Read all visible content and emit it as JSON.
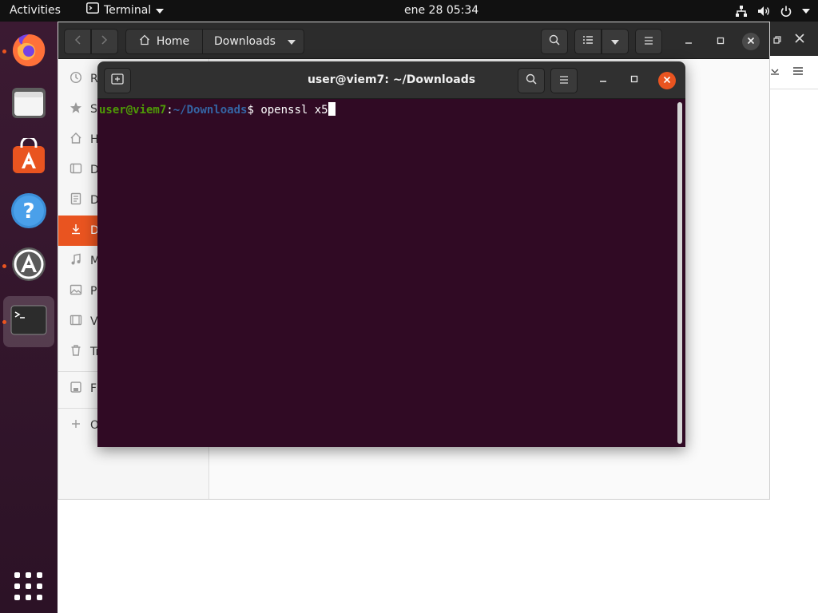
{
  "topbar": {
    "activities": "Activities",
    "app_name": "Terminal",
    "clock": "ene 28  05:34",
    "tray": {
      "network_icon": "network-wired-icon",
      "volume_icon": "volume-icon",
      "power_icon": "power-icon"
    }
  },
  "dock": {
    "items": [
      {
        "name": "Firefox",
        "icon": "firefox-icon",
        "running": true
      },
      {
        "name": "Files",
        "icon": "files-icon",
        "running": false
      },
      {
        "name": "Ubuntu Software",
        "icon": "software-icon",
        "running": false
      },
      {
        "name": "Help",
        "icon": "help-icon",
        "running": false
      },
      {
        "name": "Software Updater",
        "icon": "updater-icon",
        "running": true
      },
      {
        "name": "Terminal",
        "icon": "terminal-icon",
        "running": true,
        "active": true
      }
    ],
    "show_apps_icon": "apps-grid-icon"
  },
  "files": {
    "path": {
      "home": "Home",
      "current": "Downloads"
    },
    "sidebar": [
      {
        "label": "R",
        "icon": "recent-icon"
      },
      {
        "label": "S",
        "icon": "star-icon"
      },
      {
        "label": "H",
        "icon": "home-icon"
      },
      {
        "label": "D",
        "icon": "desktop-icon"
      },
      {
        "label": "D",
        "icon": "documents-icon"
      },
      {
        "label": "D",
        "icon": "download-icon",
        "selected": true
      },
      {
        "label": "M",
        "icon": "music-icon"
      },
      {
        "label": "P",
        "icon": "pictures-icon"
      },
      {
        "label": "V",
        "icon": "videos-icon"
      },
      {
        "label": "Tr",
        "icon": "trash-icon"
      },
      {
        "label": "Fl",
        "icon": "floppy-icon"
      },
      {
        "label": "O",
        "icon": "plus-icon"
      }
    ]
  },
  "terminal": {
    "title": "user@viem7: ~/Downloads",
    "prompt_user": "user@viem7",
    "prompt_sep": ":",
    "prompt_path": "~/Downloads",
    "prompt_symbol": "$ ",
    "command": "openssl x5"
  },
  "colors": {
    "accent": "#e95420",
    "terminal_bg": "#300a24",
    "prompt_user": "#4e9a06",
    "prompt_path": "#3465a4"
  }
}
